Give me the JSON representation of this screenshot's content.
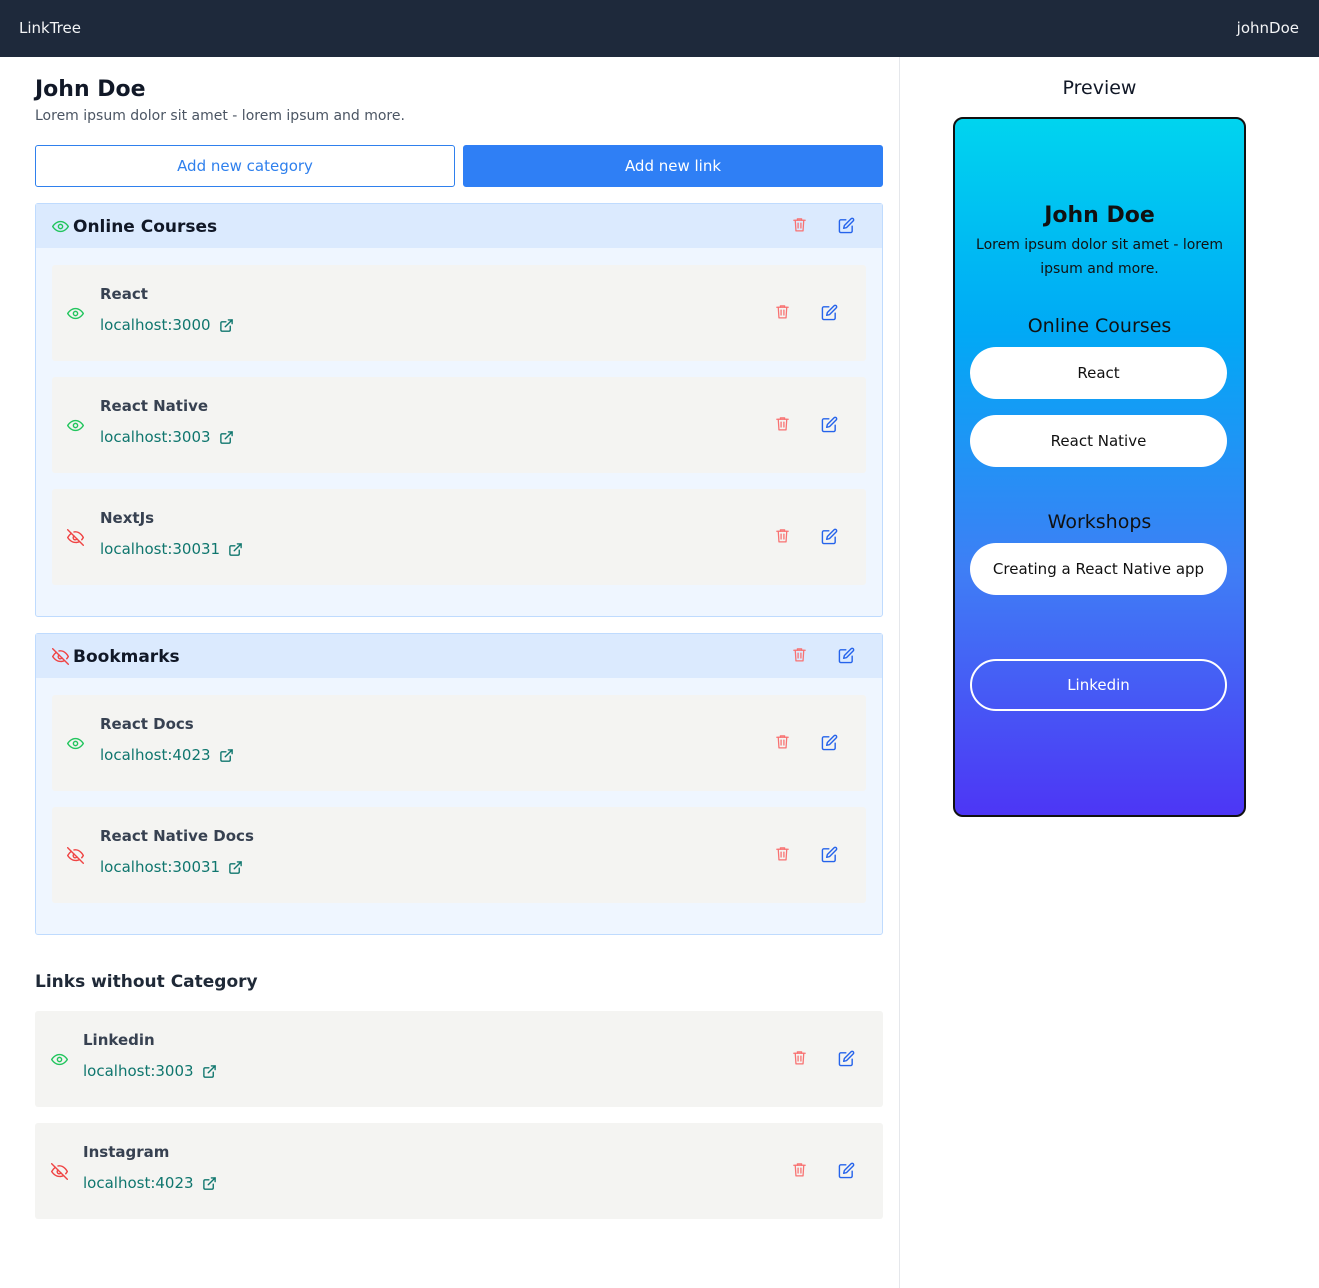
{
  "navbar": {
    "brand": "LinkTree",
    "user": "johnDoe"
  },
  "profile": {
    "name": "John Doe",
    "bio": "Lorem ipsum dolor sit amet - lorem ipsum and more."
  },
  "actions": {
    "add_category": "Add new category",
    "add_link": "Add new link"
  },
  "categories": [
    {
      "title": "Online Courses",
      "visible": true,
      "links": [
        {
          "title": "React",
          "url": "localhost:3000",
          "visible": true
        },
        {
          "title": "React Native",
          "url": "localhost:3003",
          "visible": true
        },
        {
          "title": "NextJs",
          "url": "localhost:30031",
          "visible": false
        }
      ]
    },
    {
      "title": "Bookmarks",
      "visible": false,
      "links": [
        {
          "title": "React Docs",
          "url": "localhost:4023",
          "visible": true
        },
        {
          "title": "React Native Docs",
          "url": "localhost:30031",
          "visible": false
        }
      ]
    }
  ],
  "uncategorized": {
    "title": "Links without Category",
    "links": [
      {
        "title": "Linkedin",
        "url": "localhost:3003",
        "visible": true
      },
      {
        "title": "Instagram",
        "url": "localhost:4023",
        "visible": false
      }
    ]
  },
  "preview": {
    "title": "Preview",
    "name": "John Doe",
    "bio": "Lorem ipsum dolor sit amet - lorem ipsum and more.",
    "categories": [
      {
        "title": "Online Courses",
        "links": [
          "React",
          "React Native"
        ]
      },
      {
        "title": "Workshops",
        "links": [
          "Creating a React Native app"
        ]
      }
    ],
    "uncategorized_links": [
      "Linkedin"
    ]
  },
  "icons": {
    "visible": "eye-icon",
    "hidden": "eye-off-icon",
    "delete": "trash-icon",
    "edit": "edit-icon",
    "external": "external-link-icon"
  },
  "colors": {
    "navbar": "#1e293b",
    "accent": "#2f7ff5",
    "visible": "#22c55e",
    "hidden": "#ef4444",
    "delete": "#f87171",
    "edit": "#2563eb",
    "url": "#0f766e",
    "category_bg": "#eff6ff",
    "category_header": "#dbeafe",
    "card_bg": "#f4f4f2"
  }
}
